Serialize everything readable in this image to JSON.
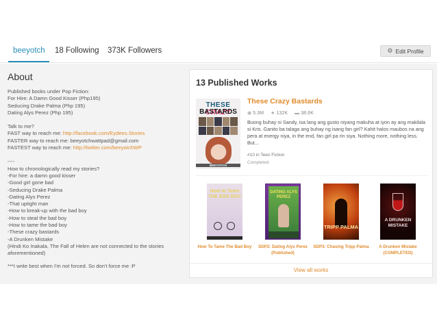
{
  "nav": {
    "username": "beeyotch",
    "following": "18 Following",
    "followers": "373K Followers",
    "edit_profile": "Edit Profile",
    "edit_icon": "gear-icon",
    "accent_color": "#2a8fb8"
  },
  "about": {
    "title": "About",
    "lines": [
      "Published books under Pop Fiction:",
      "For Hire: A Damn Good Kisser (Php195)",
      "Seducing Drake Palma (Php 195)",
      "Dating Alys Perez (Php 195)"
    ],
    "contact_lines": [
      {
        "label": "Talk to me?",
        "link": ""
      },
      {
        "label": "FAST way to reach me: ",
        "link": "http://facebook.com/Eydees.Stories"
      },
      {
        "label": "FASTER way to reach me:  beeyotchwattpad@gmail.com",
        "link": ""
      },
      {
        "label": "FASTEST way to reach me:  ",
        "link": "http://twitter.com/beeyotchWP"
      }
    ],
    "order_lines": [
      "----",
      "How to chronologically read my stories?",
      "-For hire: a damn good kisser",
      "-Good girl gone bad",
      "-Seducing Drake Palma",
      "-Dating Alys Perez",
      "-That uptight man",
      "-How to break-up with the bad boy",
      "-How to steal the bad boy",
      "-How to tame the bad boy",
      "-These crazy bastards",
      "-A Drunken Mistake",
      "(Hindi Ko Inakala, The Fall of Helen are not connected to the stories",
      "aforementioned)"
    ],
    "footer": "***I write best when I'm not forced. So don't force me :P",
    "link_color": "#e08b2c"
  },
  "works": {
    "title": "13 Published Works",
    "featured": {
      "title": "These Crazy Bastards",
      "cover": {
        "line1": "THESE",
        "line1_accent": "CRAZY",
        "line2": "BASTARDS",
        "author": "BEEYOTCH"
      },
      "reads": "5.3M",
      "votes": "132K",
      "comments": "38.6K",
      "icons": [
        "eye-icon",
        "star-icon",
        "comment-icon"
      ],
      "description": "Buong buhay ni Sandy, isa lang ang gusto niyang makuha at iyon ay ang makilala si Kris. Ganito ba talaga ang buhay ng isang fan girl? Kahit halos maubos na ang pera at energy niya, in the end, fan girl pa rin siya. Nothing more, nothing less. But...",
      "rank": "#10 in Teen Fiction",
      "status": "Completed"
    },
    "books": [
      {
        "label": "How To Tame The Bad Boy",
        "cover_text": "How to Tame THE BAD BOY"
      },
      {
        "label": "SDP2: Dating Alys Perez (Published)",
        "cover_text": "DATING ALYS PEREZ"
      },
      {
        "label": "SDP3: Chasing Tripp Palma",
        "cover_text": "TRIPP PALMA"
      },
      {
        "label": "A Drunken Mistake (COMPLETED)",
        "cover_text": "A DRUNKEN MISTAKE"
      }
    ],
    "view_all": "View all works",
    "accent_color": "#e08b2c"
  }
}
